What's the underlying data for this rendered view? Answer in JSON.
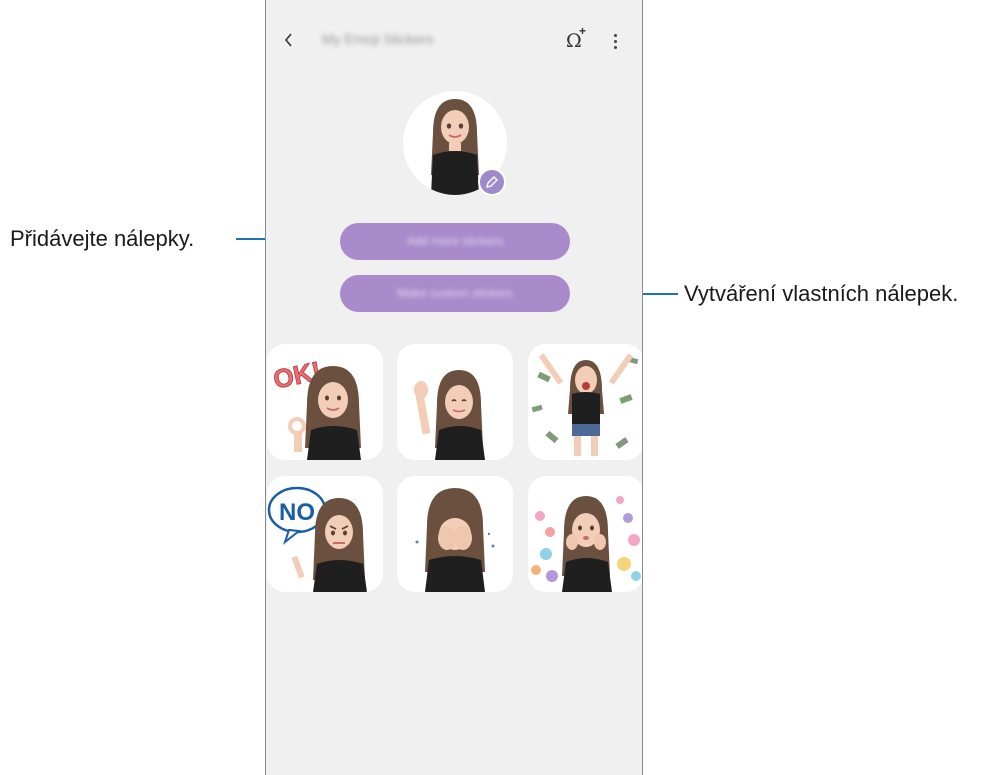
{
  "app": {
    "title": "My Emoji Stickers",
    "buttons": {
      "back_icon": "chevron-left-icon",
      "add_avatar_icon": "omega-plus-icon",
      "more_icon": "more-vertical-icon"
    },
    "primary_buttons": [
      {
        "label": "Add more stickers"
      },
      {
        "label": "Make custom stickers"
      }
    ],
    "accent_color": "#a98bcb"
  },
  "stickers": [
    {
      "name": "ok",
      "text": "OK!"
    },
    {
      "name": "wave",
      "text": ""
    },
    {
      "name": "money-rain",
      "text": ""
    },
    {
      "name": "no",
      "text": "NO"
    },
    {
      "name": "facepalm",
      "text": ""
    },
    {
      "name": "hearts",
      "text": ""
    }
  ],
  "callouts": [
    {
      "label": "Přidávejte nálepky."
    },
    {
      "label": "Vytváření vlastních nálepek."
    }
  ],
  "callout_color": "#1a74b6"
}
